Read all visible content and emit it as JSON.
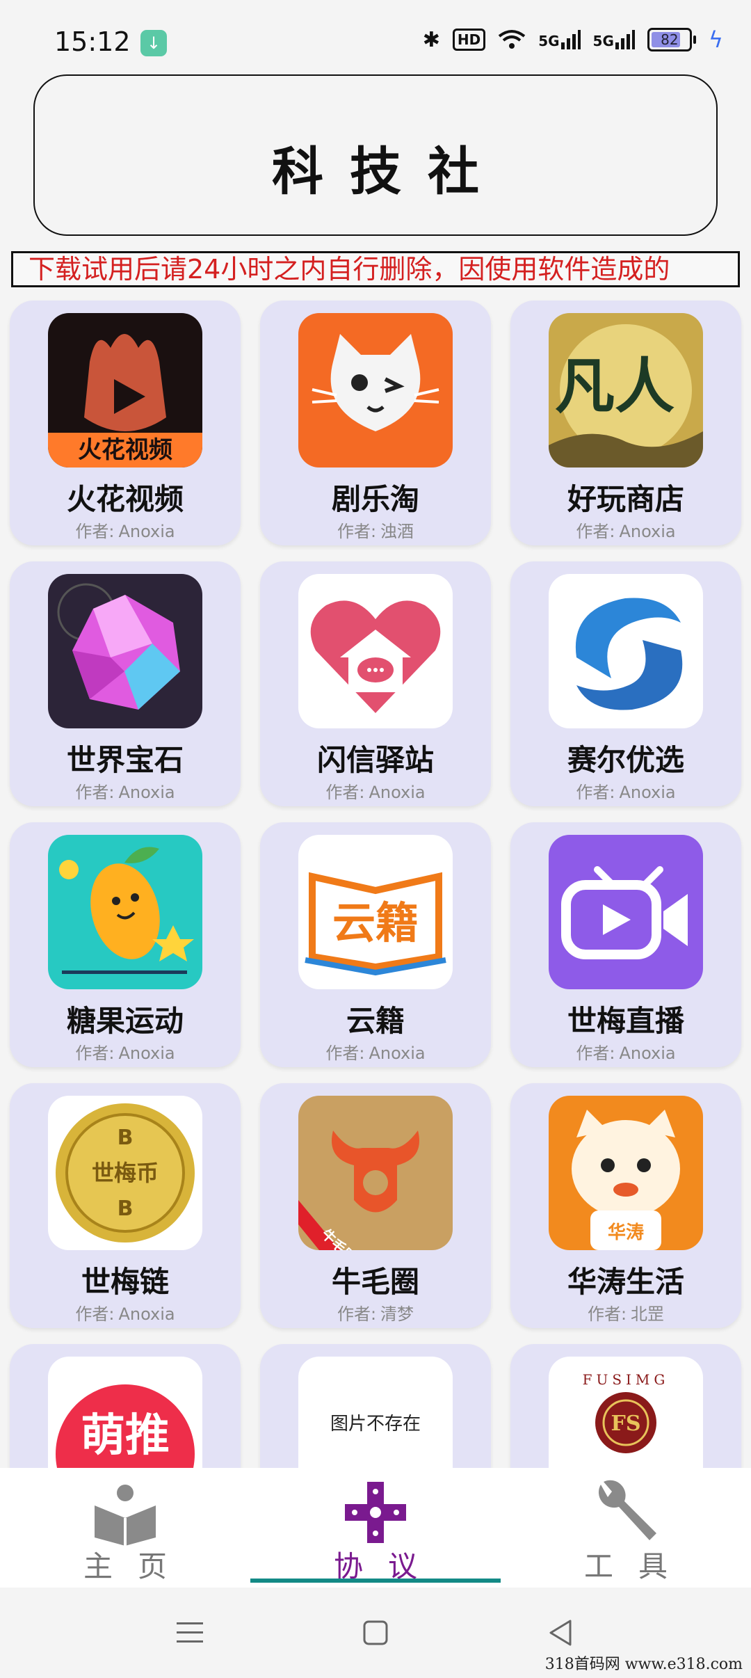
{
  "status_bar": {
    "time": "15:12",
    "hd_label": "HD",
    "net1": "5G",
    "net2": "5G",
    "battery": "82",
    "battery_level": 0.82
  },
  "header": {
    "title": "科技社"
  },
  "marquee": {
    "text": "，下载试用后请24小时之内自行删除，因使用软件造成的"
  },
  "author_prefix": "作者:",
  "apps": [
    {
      "name": "火花视频",
      "author": "Anoxia",
      "icon": "huohua-video-icon",
      "icon_text": "火花视频",
      "bg": "#1a1010",
      "fg": "#ff7a2a"
    },
    {
      "name": "剧乐淘",
      "author": "浊酒",
      "icon": "cat-face-icon",
      "icon_text": "",
      "bg": "#f46a24",
      "fg": "#ffffff"
    },
    {
      "name": "好玩商店",
      "author": "Anoxia",
      "icon": "fanren-icon",
      "icon_text": "凡人",
      "bg": "#c9a94a",
      "fg": "#1d3a25"
    },
    {
      "name": "世界宝石",
      "author": "Anoxia",
      "icon": "gem-icon",
      "icon_text": "",
      "bg": "#2c2438",
      "fg": "#e05be0"
    },
    {
      "name": "闪信驿站",
      "author": "Anoxia",
      "icon": "heart-house-icon",
      "icon_text": "",
      "bg": "#ffffff",
      "fg": "#e2506f"
    },
    {
      "name": "赛尔优选",
      "author": "Anoxia",
      "icon": "swirl-logo-icon",
      "icon_text": "",
      "bg": "#ffffff",
      "fg": "#2a6fc0"
    },
    {
      "name": "糖果运动",
      "author": "Anoxia",
      "icon": "mango-runner-icon",
      "icon_text": "",
      "bg": "#27c9c2",
      "fg": "#ffb020"
    },
    {
      "name": "云籍",
      "author": "Anoxia",
      "icon": "book-icon",
      "icon_text": "云籍",
      "bg": "#ffffff",
      "fg": "#f07a18"
    },
    {
      "name": "世梅直播",
      "author": "Anoxia",
      "icon": "tv-play-icon",
      "icon_text": "",
      "bg": "#8e5be8",
      "fg": "#ffffff"
    },
    {
      "name": "世梅链",
      "author": "Anoxia",
      "icon": "gold-coin-icon",
      "icon_text": "世梅币",
      "bg": "#ffffff",
      "fg": "#c99a1a"
    },
    {
      "name": "牛毛圈",
      "author": "清梦",
      "icon": "bull-icon",
      "icon_text": "牛毛圈",
      "bg": "#c9a062",
      "fg": "#e8552a"
    },
    {
      "name": "华涛生活",
      "author": "北罡",
      "icon": "mascot-icon",
      "icon_text": "华涛",
      "bg": "#f28a1e",
      "fg": "#ffffff"
    },
    {
      "name": "",
      "author": "",
      "icon": "mengtui-icon",
      "icon_text": "萌推",
      "bg": "#ffffff",
      "fg": "#ee2e4a"
    },
    {
      "name": "",
      "author": "",
      "icon": "missing-image-icon",
      "icon_text": "图片不存在",
      "bg": "#ffffff",
      "fg": "#222222"
    },
    {
      "name": "",
      "author": "",
      "icon": "fusimg-logo-icon",
      "icon_text": "FUSIMG",
      "bg": "#ffffff",
      "fg": "#8a1a1a"
    }
  ],
  "nav": {
    "items": [
      {
        "label": "主页",
        "icon": "reader-icon"
      },
      {
        "label": "协议",
        "icon": "gamepad-cross-icon"
      },
      {
        "label": "工具",
        "icon": "wrench-icon"
      }
    ],
    "active": "协议"
  },
  "watermark": "318首码网  www.e318.com"
}
